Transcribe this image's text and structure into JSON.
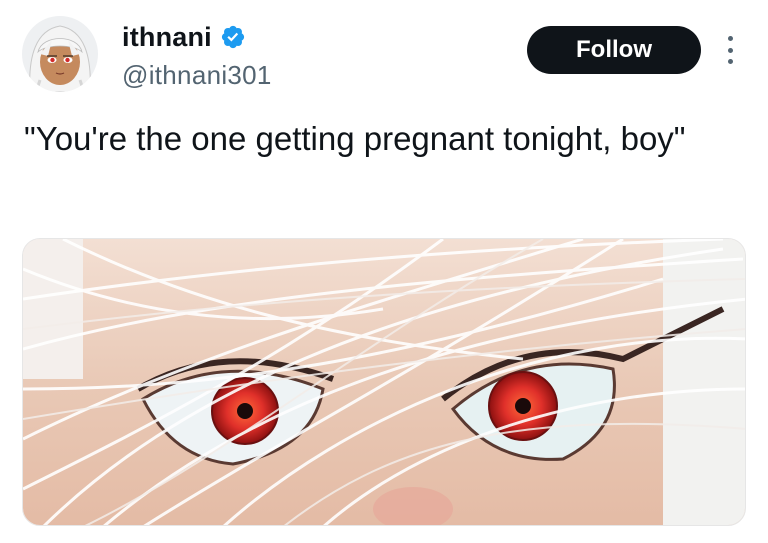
{
  "author": {
    "display_name": "ithnani",
    "handle": "@ithnani301",
    "verified": true,
    "avatar_icon": "anime-girl-avatar-icon",
    "verified_icon": "verified-badge-icon"
  },
  "actions": {
    "follow_label": "Follow",
    "more_icon": "more-options-icon"
  },
  "tweet": {
    "text": "\"You're the one getting pregnant tonight, boy\""
  },
  "media": {
    "type": "image",
    "subject": "close-up of red anime eyes behind white hair"
  },
  "colors": {
    "text_primary": "#0f1419",
    "text_secondary": "#536471",
    "verified_blue": "#1d9bf0",
    "button_bg": "#0f1419",
    "eye_red": "#e0302a"
  }
}
